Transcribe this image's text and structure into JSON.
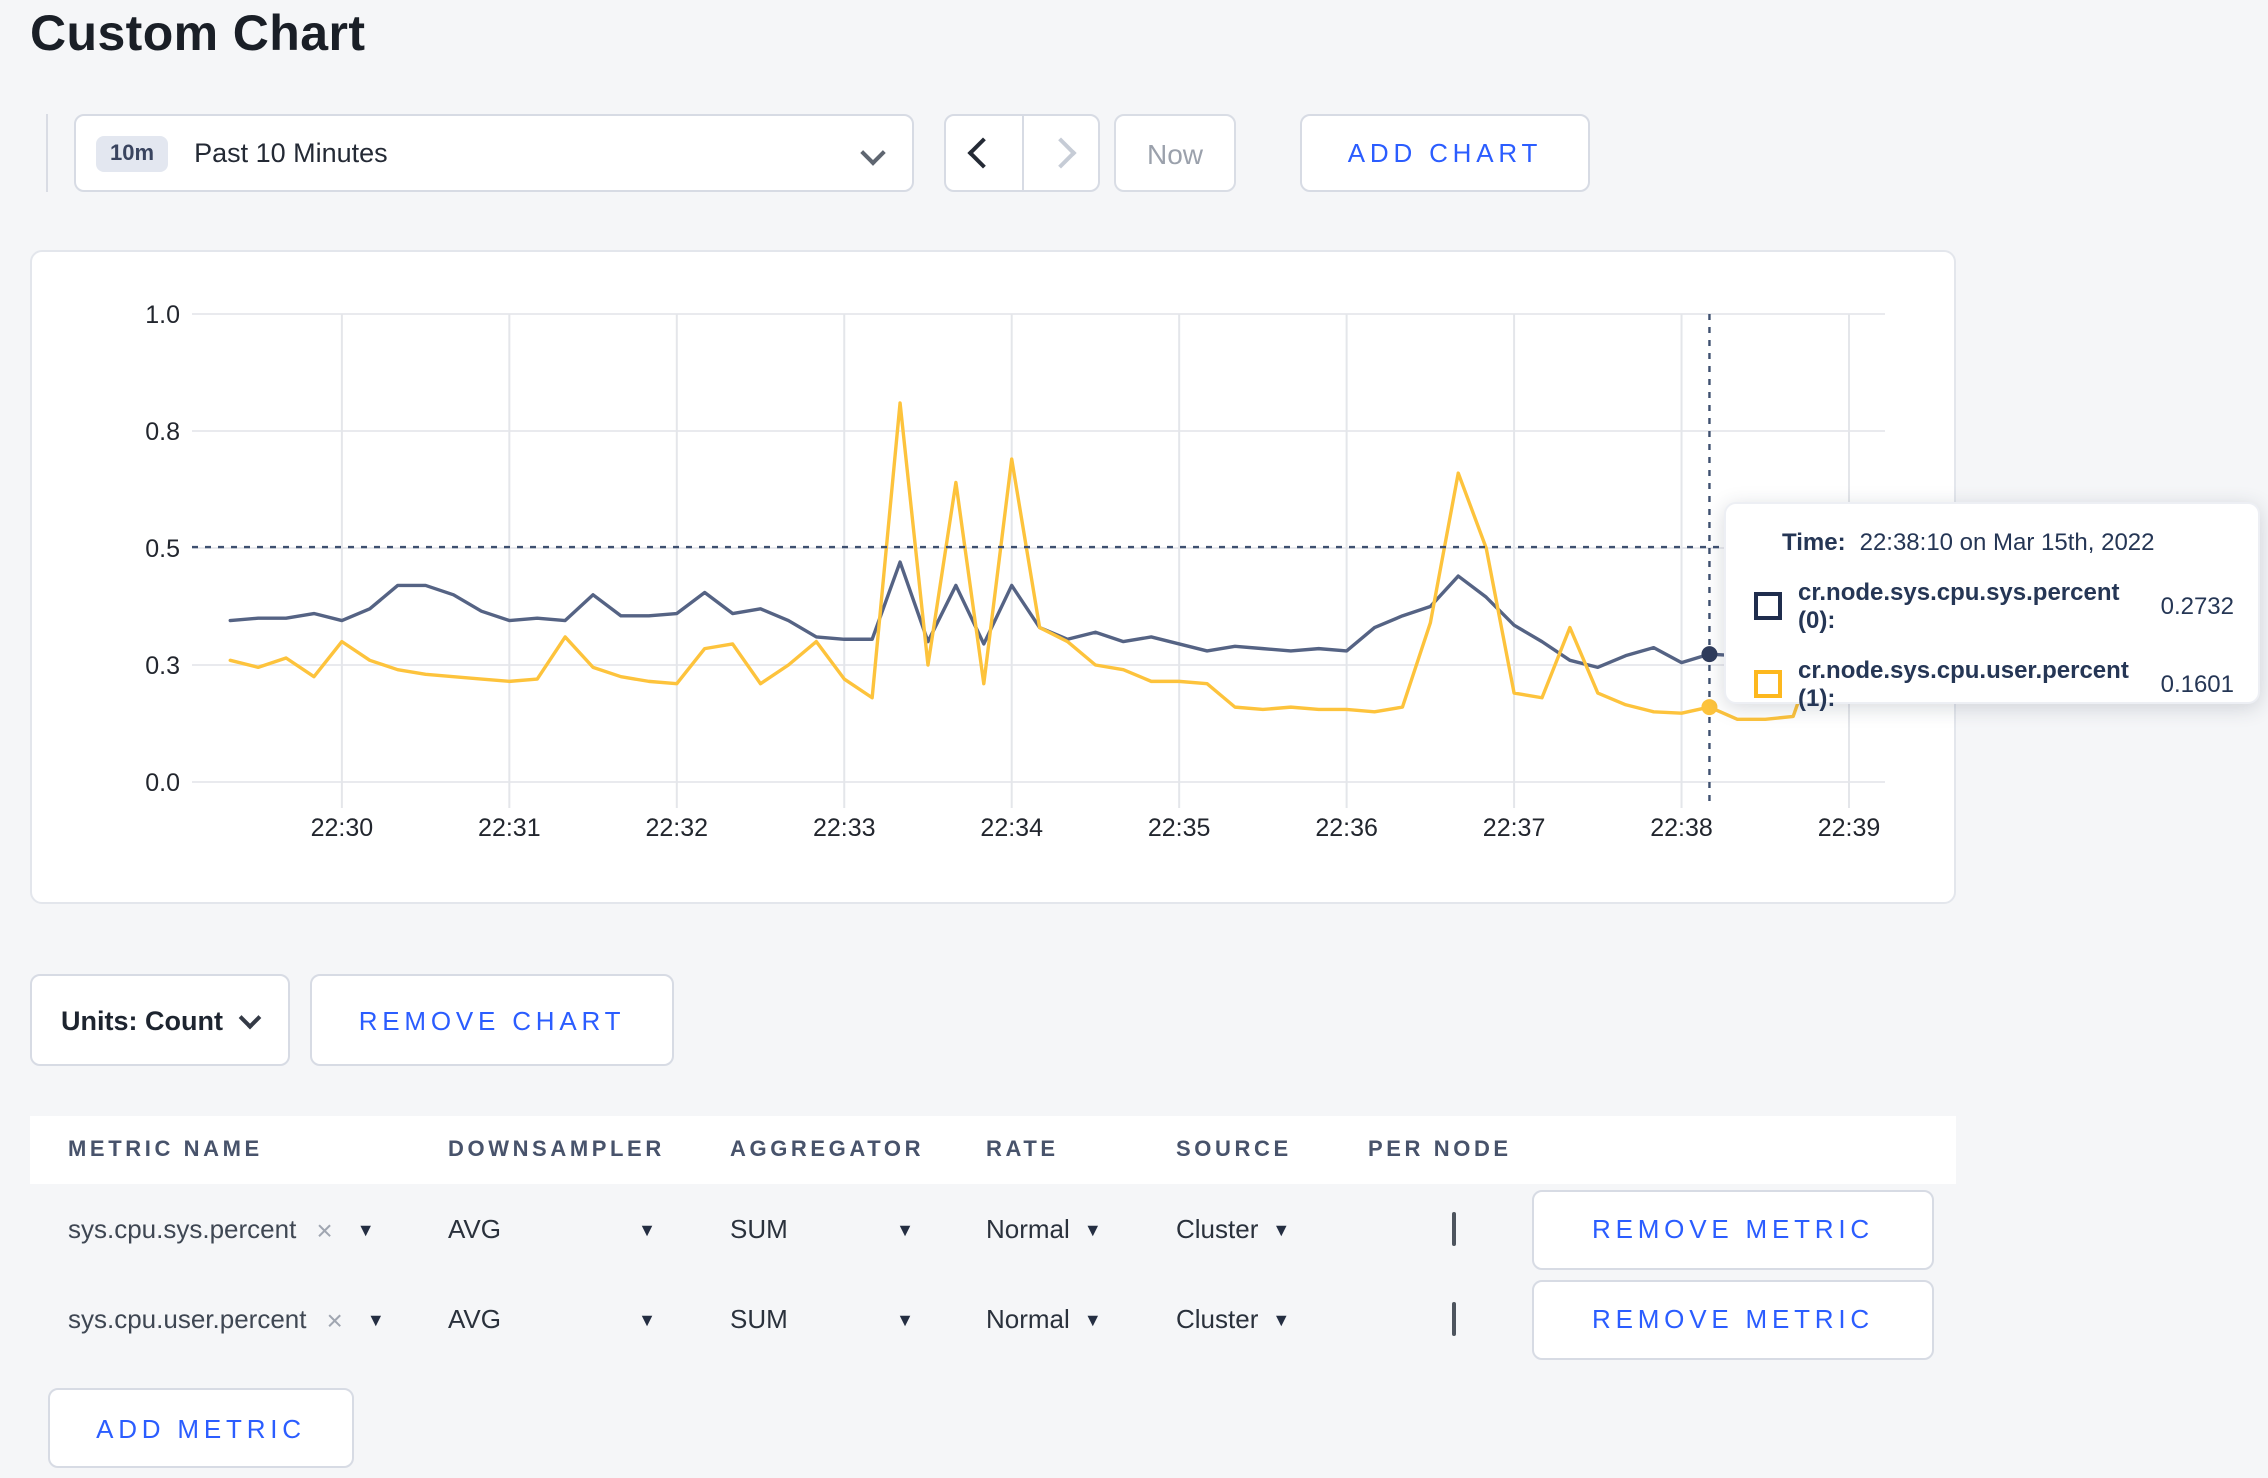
{
  "page": {
    "title": "Custom Chart"
  },
  "icons": {
    "close": "×",
    "caret_down": "▼"
  },
  "colors": {
    "accent_blue": "#2b5dff",
    "series_sys_line": "#556384",
    "series_user_line": "#fdc33c",
    "page_bg": "#f5f6f8"
  },
  "toolbar": {
    "time_window_badge": "10m",
    "time_window_label": "Past 10 Minutes",
    "now_label": "Now",
    "add_chart_label": "ADD CHART"
  },
  "chart_controls": {
    "units_label": "Units: Count",
    "remove_chart_label": "REMOVE CHART"
  },
  "tooltip": {
    "time_label": "Time:",
    "time_value": "22:38:10 on Mar 15th, 2022",
    "series": [
      {
        "name": "cr.node.sys.cpu.sys.percent (0):",
        "value": "0.2732"
      },
      {
        "name": "cr.node.sys.cpu.user.percent (1):",
        "value": "0.1601"
      }
    ]
  },
  "metrics_table": {
    "headers": {
      "metric_name": "METRIC NAME",
      "downsampler": "DOWNSAMPLER",
      "aggregator": "AGGREGATOR",
      "rate": "RATE",
      "source": "SOURCE",
      "per_node": "PER NODE"
    },
    "rows": [
      {
        "metric_name": "sys.cpu.sys.percent",
        "downsampler": "AVG",
        "aggregator": "SUM",
        "rate": "Normal",
        "source": "Cluster",
        "per_node_checked": false,
        "remove_label": "REMOVE METRIC"
      },
      {
        "metric_name": "sys.cpu.user.percent",
        "downsampler": "AVG",
        "aggregator": "SUM",
        "rate": "Normal",
        "source": "Cluster",
        "per_node_checked": false,
        "remove_label": "REMOVE METRIC"
      }
    ],
    "add_metric_label": "ADD METRIC"
  },
  "chart_data": {
    "type": "line",
    "title": "",
    "x_unit": "seconds relative to 22:30:00",
    "domain": {
      "t_min": -53.7,
      "t_max": 552.9
    },
    "x_axis": {
      "ticks": [
        {
          "t": 0,
          "label": "22:30"
        },
        {
          "t": 60,
          "label": "22:31"
        },
        {
          "t": 120,
          "label": "22:32"
        },
        {
          "t": 180,
          "label": "22:33"
        },
        {
          "t": 240,
          "label": "22:34"
        },
        {
          "t": 300,
          "label": "22:35"
        },
        {
          "t": 360,
          "label": "22:36"
        },
        {
          "t": 420,
          "label": "22:37"
        },
        {
          "t": 480,
          "label": "22:38"
        },
        {
          "t": 540,
          "label": "22:39"
        }
      ]
    },
    "y_axis": {
      "ylim": [
        0,
        1
      ],
      "ticks": [
        {
          "value": 1.0,
          "label": "1.0"
        },
        {
          "value": 0.75,
          "label": "0.8"
        },
        {
          "value": 0.5,
          "label": "0.5"
        },
        {
          "value": 0.25,
          "label": "0.3"
        },
        {
          "value": 0.0,
          "label": "0.0"
        }
      ]
    },
    "x": [
      -40,
      -30,
      -20,
      -10,
      0,
      10,
      20,
      30,
      40,
      50,
      60,
      70,
      80,
      90,
      100,
      110,
      120,
      130,
      140,
      150,
      160,
      170,
      180,
      190,
      200,
      210,
      220,
      230,
      240,
      250,
      260,
      270,
      280,
      290,
      300,
      310,
      320,
      330,
      340,
      350,
      360,
      370,
      380,
      390,
      400,
      410,
      420,
      430,
      440,
      450,
      460,
      470,
      480,
      490,
      500,
      510,
      520,
      530,
      540,
      550
    ],
    "series": [
      {
        "name": "cr.node.sys.cpu.sys.percent",
        "node": "0",
        "color": "#556384",
        "dot_color": "#2f3c5c",
        "values": [
          0.345,
          0.35,
          0.35,
          0.36,
          0.345,
          0.37,
          0.42,
          0.42,
          0.4,
          0.365,
          0.345,
          0.35,
          0.345,
          0.4,
          0.355,
          0.355,
          0.36,
          0.405,
          0.36,
          0.37,
          0.345,
          0.31,
          0.305,
          0.305,
          0.47,
          0.3,
          0.42,
          0.295,
          0.42,
          0.33,
          0.305,
          0.32,
          0.3,
          0.31,
          0.295,
          0.28,
          0.29,
          0.285,
          0.28,
          0.285,
          0.28,
          0.33,
          0.355,
          0.375,
          0.44,
          0.395,
          0.335,
          0.3,
          0.26,
          0.245,
          0.27,
          0.287,
          0.255,
          0.2732,
          0.27,
          0.28,
          0.3,
          0.3,
          0.305,
          0.3
        ]
      },
      {
        "name": "cr.node.sys.cpu.user.percent",
        "node": "1",
        "color": "#fdc33c",
        "dot_color": "#fdc33c",
        "values": [
          0.26,
          0.245,
          0.265,
          0.225,
          0.3,
          0.26,
          0.24,
          0.23,
          0.225,
          0.22,
          0.215,
          0.22,
          0.31,
          0.245,
          0.225,
          0.215,
          0.21,
          0.285,
          0.295,
          0.21,
          0.25,
          0.3,
          0.22,
          0.18,
          0.81,
          0.25,
          0.64,
          0.21,
          0.69,
          0.33,
          0.3,
          0.25,
          0.24,
          0.215,
          0.215,
          0.21,
          0.16,
          0.155,
          0.16,
          0.155,
          0.155,
          0.15,
          0.16,
          0.34,
          0.66,
          0.5,
          0.19,
          0.18,
          0.33,
          0.19,
          0.165,
          0.15,
          0.147,
          0.1601,
          0.134,
          0.134,
          0.14,
          0.31,
          0.2,
          0.27
        ]
      }
    ],
    "crosshair": {
      "t": 490,
      "time_label": "22:38:10",
      "hover_value": 0.502,
      "point_values": [
        0.2732,
        0.1601
      ]
    },
    "legend_position": "none",
    "grid": true
  }
}
